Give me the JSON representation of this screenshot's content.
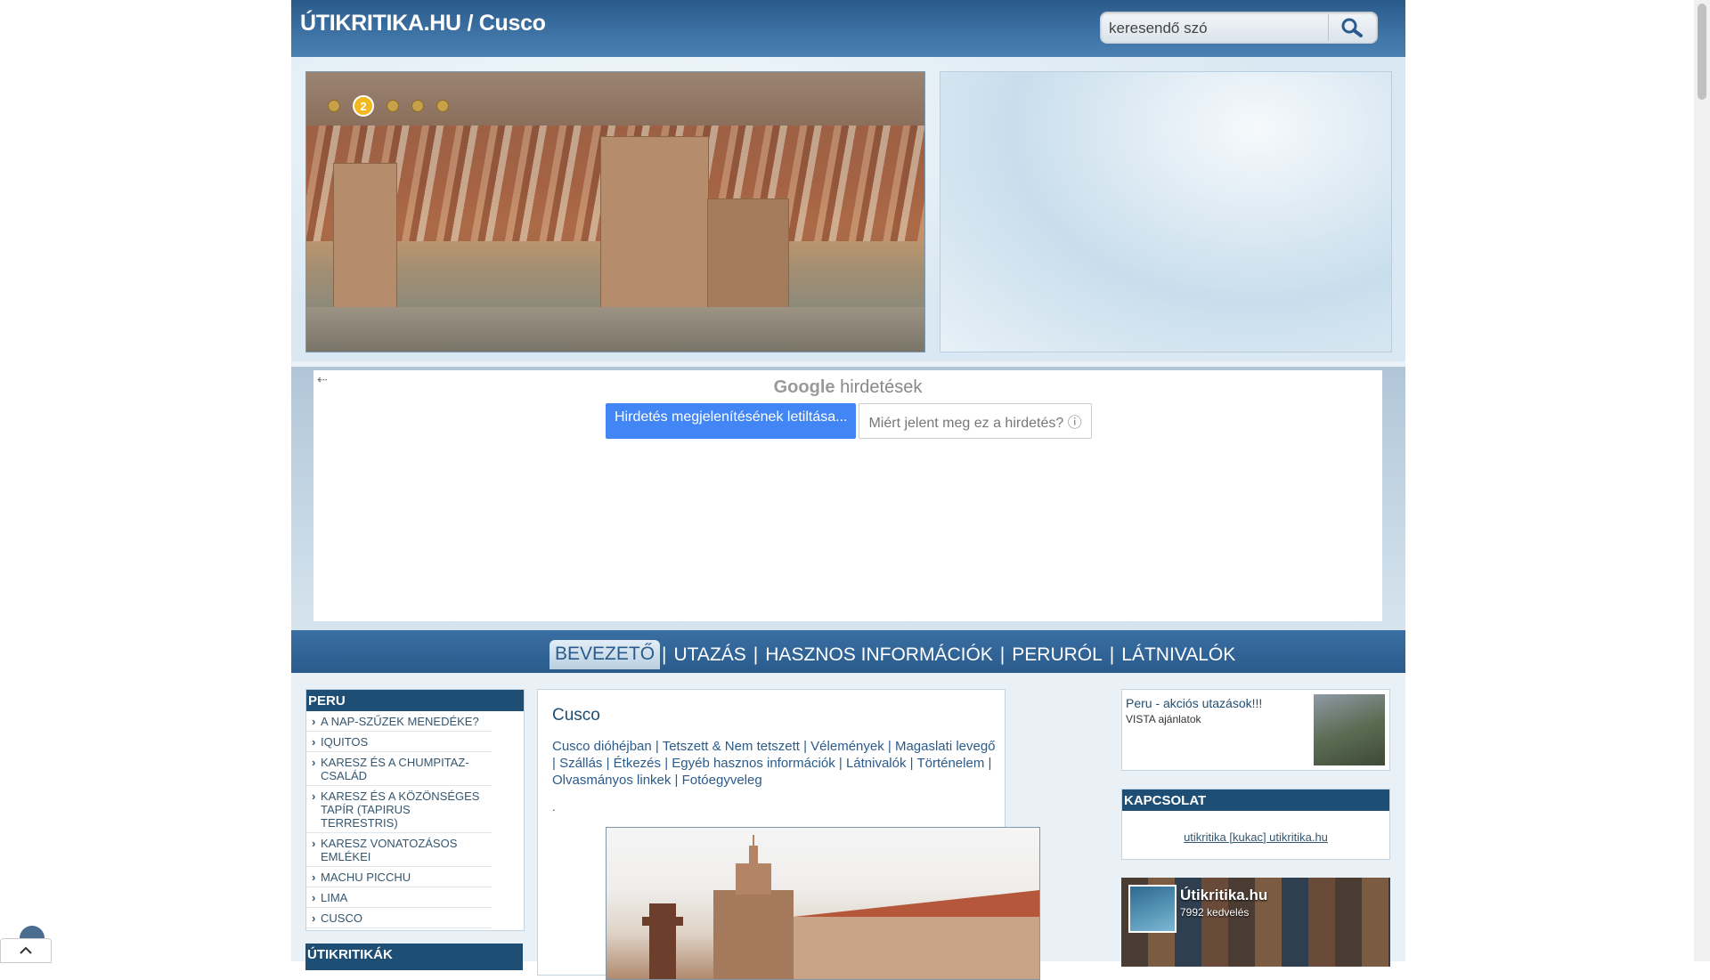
{
  "header": {
    "title": "ÚTIKRITIKA.HU / Cusco",
    "search_placeholder": "keresendő szó"
  },
  "slider": {
    "active_dot": "2"
  },
  "ad": {
    "brand": "Google",
    "label": "hirdetések",
    "block_button": "Hirdetés megjelenítésének letiltása...",
    "why_button": "Miért jelent meg ez a hirdetés? ⓘ"
  },
  "nav": {
    "tabs": [
      "BEVEZETŐ",
      "UTAZÁS",
      "HASZNOS INFORMÁCIÓK",
      "PERURÓL",
      "LÁTNIVALÓK"
    ],
    "separator": "|"
  },
  "sidebar": {
    "title": "PERU",
    "items": [
      "A NAP-SZŰZEK MENEDÉKE?",
      "IQUITOS",
      "KARESZ ÉS A CHUMPITAZ-CSALÁD",
      "KARESZ ÉS A KÖZÖNSÉGES TAPÍR (TAPIRUS TERRESTRIS)",
      "KARESZ VONATOZÁSOS EMLÉKEI",
      "MACHU PICCHU",
      "LIMA",
      "CUSCO"
    ],
    "second_title": "ÚTIKRITIKÁK"
  },
  "main": {
    "title": "Cusco",
    "links": [
      "Cusco dióhéjban",
      "Tetszett & Nem tetszett",
      "Vélemények",
      "Magaslati levegő",
      "Szállás",
      "Étkezés",
      "Egyéb hasznos információk",
      "Látnivalók",
      "Történelem",
      "Olvasmányos linkek",
      "Fotóegyveleg"
    ],
    "dot_text": "."
  },
  "right": {
    "promo_title": "Peru - akciós utazások!!!",
    "promo_sub": "VISTA ajánlatok",
    "contact_title": "KAPCSOLAT",
    "contact_email": "utikritika [kukac] utikritika.hu",
    "fb_name": "Útikritika.hu",
    "fb_likes": "7992 kedvelés"
  }
}
